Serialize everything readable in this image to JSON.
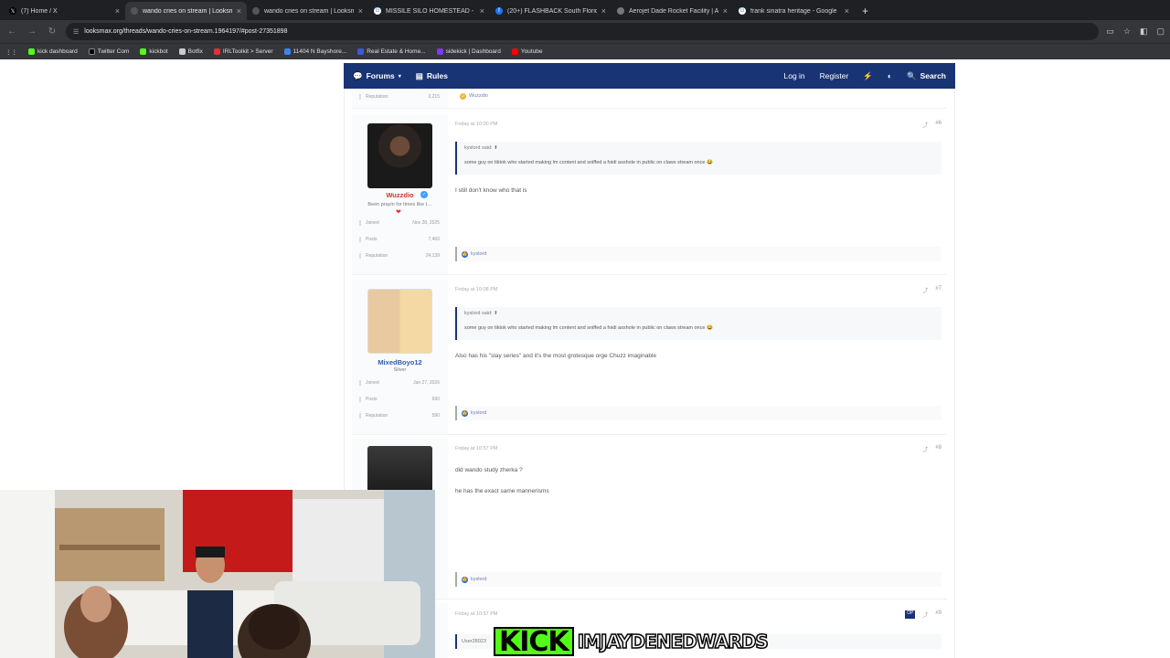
{
  "tabs": [
    {
      "title": "(7) Home / X",
      "icon": "x-icon"
    },
    {
      "title": "wando cries on stream | Looksmax.org",
      "icon": "site-icon",
      "active": true
    },
    {
      "title": "wando cries on stream | Looksmax",
      "icon": "site-icon"
    },
    {
      "title": "MISSILE SILO HOMESTEAD - Google",
      "icon": "google-icon"
    },
    {
      "title": "(20+) FLASHBACK South Florida",
      "icon": "facebook-icon"
    },
    {
      "title": "Aerojet Dade Rocket Facility | A",
      "icon": "site-icon"
    },
    {
      "title": "frank sinatra heritage - Google",
      "icon": "google-icon"
    }
  ],
  "address": {
    "url": "looksmax.org/threads/wando-cries-on-stream.1964197/#post-27351898"
  },
  "bookmarks": [
    {
      "label": "kick dashboard",
      "color": "#53fc18"
    },
    {
      "label": "Twitter Com",
      "color": "#000000"
    },
    {
      "label": "kickbot",
      "color": "#53fc18"
    },
    {
      "label": "Botfix",
      "color": "#cccccc"
    },
    {
      "label": "IRLToolkit > Server",
      "color": "#d33"
    },
    {
      "label": "11404 N Bayshore...",
      "color": "#3b82f6"
    },
    {
      "label": "Real Estate & Home...",
      "color": "#3b5bdb"
    },
    {
      "label": "sidekick | Dashboard",
      "color": "#7c3aed"
    },
    {
      "label": "Youtube",
      "color": "#ff0000"
    }
  ],
  "forum_nav": {
    "forums": "Forums",
    "rules": "Rules",
    "login": "Log in",
    "register": "Register",
    "search": "Search"
  },
  "prev_post": {
    "rep_label": "Reputation:",
    "rep_value": "2,215",
    "reaction_user": "Wuzzdio"
  },
  "posts": [
    {
      "user": "Wuzzdio",
      "user_title": "Been prayin for times like t…",
      "joined_label": "Joined",
      "joined": "Nov 28, 2025",
      "posts_label": "Posts",
      "posts": "7,460",
      "rep_label": "Reputation",
      "rep": "24,139",
      "date": "Friday at 10:00 PM",
      "num": "#6",
      "quote_author": "kyslord said:",
      "quote_text": "some guy on tiktok who started making lm content and sniffed a foidi asshole in public on claws stream once",
      "text": "I still don't know who that is",
      "reaction": "kyslord"
    },
    {
      "user": "MixedBoyo12",
      "user_title": "Silver",
      "joined_label": "Joined",
      "joined": "Jan 27, 2026",
      "posts_label": "Posts",
      "posts": "690",
      "rep_label": "Reputation",
      "rep": "590",
      "date": "Friday at 10:08 PM",
      "num": "#7",
      "quote_author": "kyslord said:",
      "quote_text": "some guy on tiktok who started making lm content and sniffed a foidi asshole in public on claws stream once",
      "text": "Also has his \"slay series\" and it's the most grotesque orge Chuzz imaginable",
      "reaction": "kyslord"
    },
    {
      "date": "Friday at 10:57 PM",
      "num": "#8",
      "text1": "did wando study zherka ?",
      "text2": "he has the exact same mannerisms",
      "reaction": "kyslord"
    },
    {
      "date": "Friday at 10:57 PM",
      "num": "#9",
      "user_partial": "User28023"
    }
  ],
  "overlay": {
    "logo": "KICK",
    "handle": "IMJAYDENEDWARDS"
  }
}
